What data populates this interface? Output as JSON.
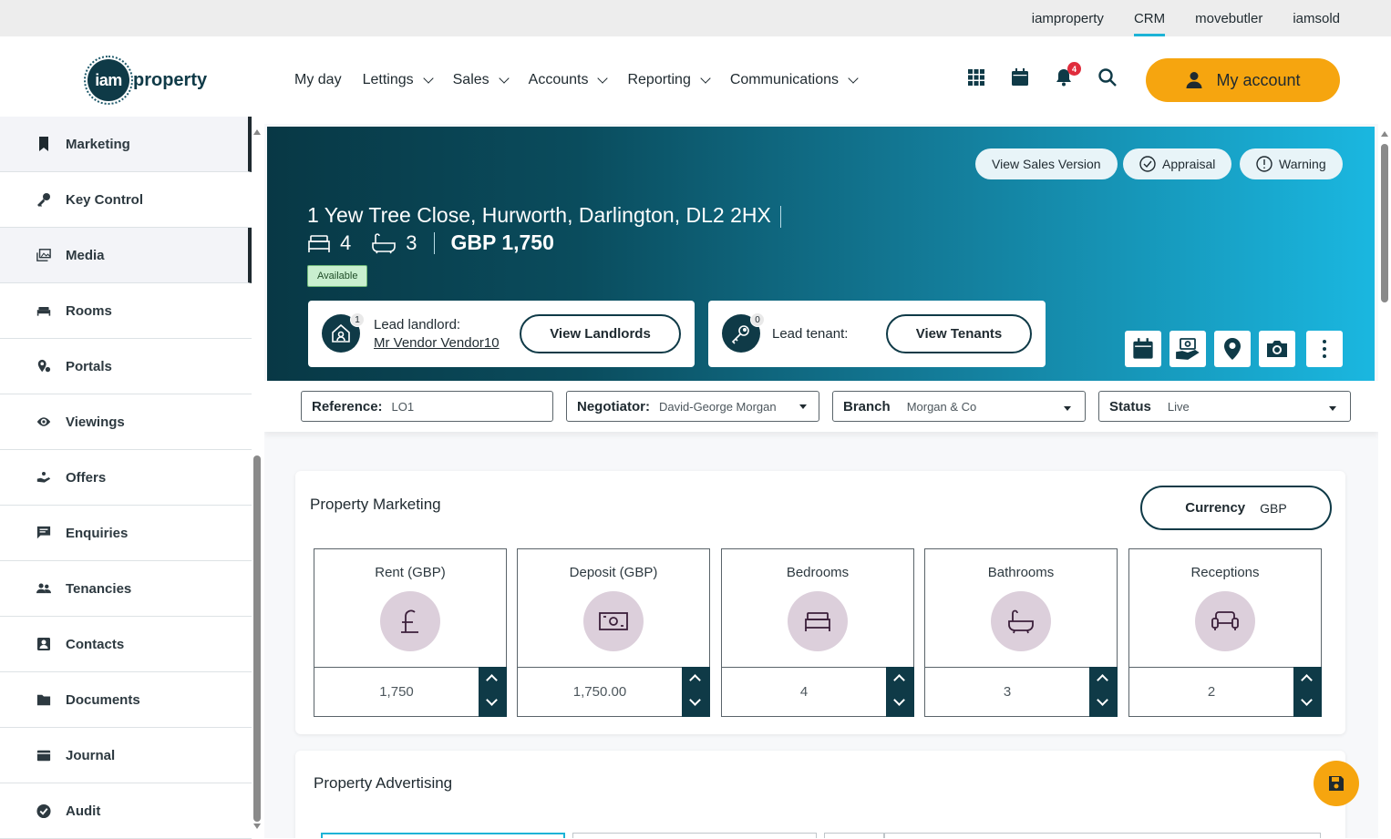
{
  "topbar": {
    "sites": [
      "iamproperty",
      "CRM",
      "movebutler",
      "iamsold"
    ],
    "active": "CRM"
  },
  "logo": {
    "badge": "iam",
    "word": "property"
  },
  "nav": {
    "items": [
      {
        "label": "My day"
      },
      {
        "label": "Lettings"
      },
      {
        "label": "Sales"
      },
      {
        "label": "Accounts"
      },
      {
        "label": "Reporting"
      },
      {
        "label": "Communications"
      }
    ],
    "notification_count": "4",
    "account_label": "My account"
  },
  "sidebar": {
    "items": [
      {
        "label": "Marketing",
        "icon": "bookmark-icon"
      },
      {
        "label": "Key Control",
        "icon": "key-icon"
      },
      {
        "label": "Media",
        "icon": "images-icon"
      },
      {
        "label": "Rooms",
        "icon": "bed-icon"
      },
      {
        "label": "Portals",
        "icon": "portals-icon"
      },
      {
        "label": "Viewings",
        "icon": "eye-icon"
      },
      {
        "label": "Offers",
        "icon": "hand-coin-icon"
      },
      {
        "label": "Enquiries",
        "icon": "message-icon"
      },
      {
        "label": "Tenancies",
        "icon": "users-icon"
      },
      {
        "label": "Contacts",
        "icon": "contact-card-icon"
      },
      {
        "label": "Documents",
        "icon": "folder-icon"
      },
      {
        "label": "Journal",
        "icon": "journal-icon"
      },
      {
        "label": "Audit",
        "icon": "check-circle-icon"
      }
    ]
  },
  "hero": {
    "buttons": {
      "sales_version": "View Sales Version",
      "appraisal": "Appraisal",
      "warning": "Warning"
    },
    "address": "1 Yew Tree Close, Hurworth, Darlington, DL2 2HX",
    "bedrooms": "4",
    "bathrooms": "3",
    "price": "GBP 1,750",
    "status_badge": "Available",
    "landlord": {
      "count": "1",
      "label": "Lead landlord:",
      "name": "Mr Vendor Vendor10",
      "button": "View Landlords"
    },
    "tenant": {
      "count": "0",
      "label": "Lead tenant:",
      "button": "View Tenants"
    }
  },
  "fields": {
    "reference": {
      "label": "Reference:",
      "value": "LO1"
    },
    "negotiator": {
      "label": "Negotiator:",
      "value": "David-George Morgan"
    },
    "branch": {
      "label": "Branch",
      "value": "Morgan & Co"
    },
    "status": {
      "label": "Status",
      "value": "Live"
    }
  },
  "marketing": {
    "title": "Property Marketing",
    "currency": {
      "label": "Currency",
      "value": "GBP"
    },
    "stats": [
      {
        "label": "Rent (GBP)",
        "value": "1,750",
        "icon": "pound-icon"
      },
      {
        "label": "Deposit (GBP)",
        "value": "1,750.00",
        "icon": "banknote-icon"
      },
      {
        "label": "Bedrooms",
        "value": "4",
        "icon": "bed-icon"
      },
      {
        "label": "Bathrooms",
        "value": "3",
        "icon": "bath-icon"
      },
      {
        "label": "Receptions",
        "value": "2",
        "icon": "sofa-icon"
      }
    ]
  },
  "advertising": {
    "title": "Property Advertising"
  },
  "colors": {
    "accent": "#f6a50f",
    "dark": "#0f3a47",
    "hero_start": "#083845",
    "hero_end": "#1ab7e0",
    "stat_icon_bg": "#dccfdb"
  }
}
